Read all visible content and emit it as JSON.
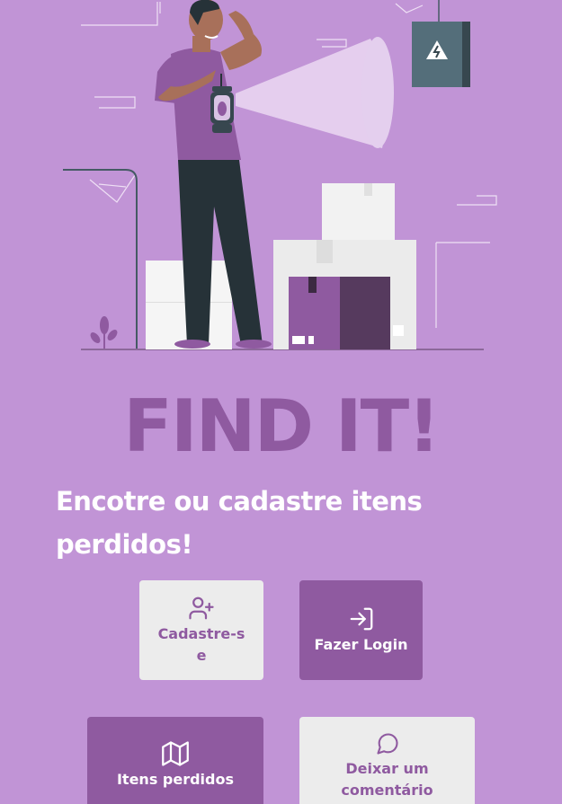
{
  "app": {
    "title": "FIND IT!",
    "tagline": "Encotre ou cadastre itens perdidos!"
  },
  "illustration": {
    "name": "man-with-lantern-illustration",
    "colors": {
      "background": "#c194d6",
      "shirt": "#8f5aa0",
      "pants": "#263238",
      "skin": "#a8705a",
      "box": "#eeeeee",
      "box_purple": "#8f5aa0",
      "box_dark": "#563a5e",
      "panel": "#455a64"
    }
  },
  "actions": [
    {
      "id": "signup",
      "label": "Cadastre-se",
      "icon": "user-plus-icon",
      "style": "light"
    },
    {
      "id": "login",
      "label": "Fazer Login",
      "icon": "login-icon",
      "style": "dark"
    },
    {
      "id": "items",
      "label": "Itens perdidos",
      "icon": "map-icon",
      "style": "dark"
    },
    {
      "id": "comment",
      "label": "Deixar um comentário",
      "icon": "message-circle-icon",
      "style": "light"
    }
  ],
  "colors": {
    "accent": "#8f5aa0",
    "card_light": "#ececec",
    "text_light": "#ffffff"
  }
}
